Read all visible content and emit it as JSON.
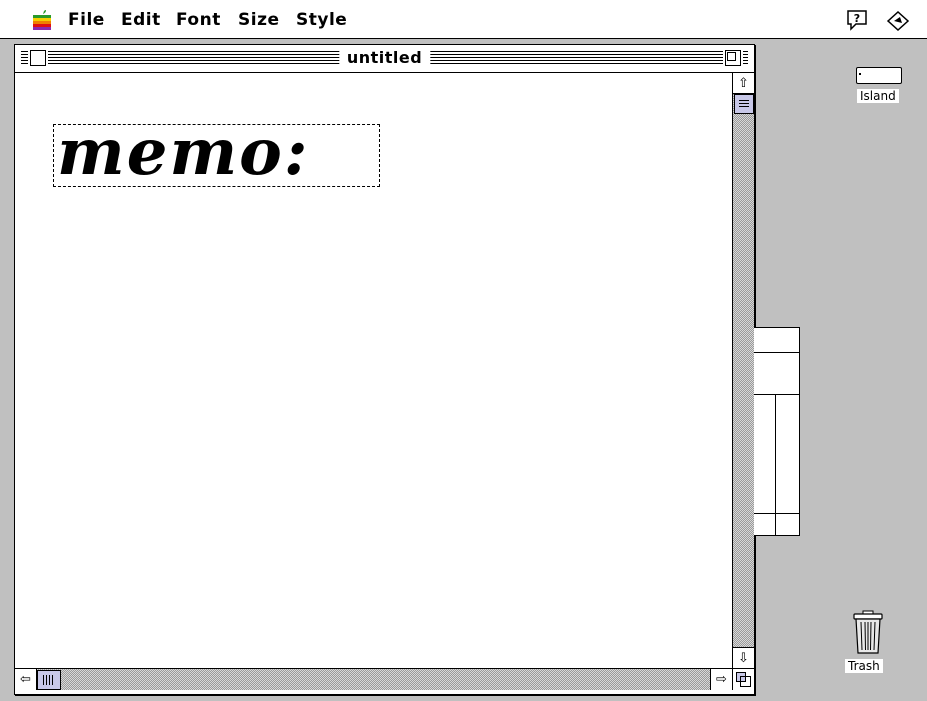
{
  "menubar": {
    "apple_icon": "apple-menu-icon",
    "items": [
      "File",
      "Edit",
      "Font",
      "Size",
      "Style"
    ],
    "help_icon": "help-balloon-icon",
    "app_icon": "application-menu-icon"
  },
  "window": {
    "title": "untitled",
    "content_text": "memo:"
  },
  "desktop": {
    "disk_label": "Island",
    "trash_label": "Trash"
  },
  "colors": {
    "desktop": "#c0c0c0",
    "scroll_thumb": "#c8c8e8"
  }
}
